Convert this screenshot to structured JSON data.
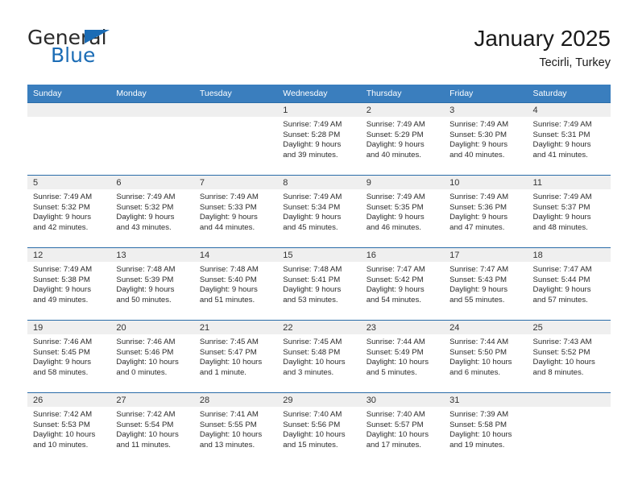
{
  "brand": {
    "name_top": "General",
    "name_bottom": "Blue",
    "triangle_icon": "triangle-icon",
    "accent_color": "#1b6cb5"
  },
  "header": {
    "title": "January 2025",
    "subtitle": "Tecirli, Turkey"
  },
  "theme": {
    "header_blue": "#3a7ebe",
    "row_divider_blue": "#2a6ca8",
    "daynum_band_gray": "#efefef"
  },
  "calendar": {
    "weekdays": [
      "Sunday",
      "Monday",
      "Tuesday",
      "Wednesday",
      "Thursday",
      "Friday",
      "Saturday"
    ],
    "weeks": [
      [
        {
          "day": "",
          "lines": []
        },
        {
          "day": "",
          "lines": []
        },
        {
          "day": "",
          "lines": []
        },
        {
          "day": "1",
          "lines": [
            "Sunrise: 7:49 AM",
            "Sunset: 5:28 PM",
            "Daylight: 9 hours",
            "and 39 minutes."
          ]
        },
        {
          "day": "2",
          "lines": [
            "Sunrise: 7:49 AM",
            "Sunset: 5:29 PM",
            "Daylight: 9 hours",
            "and 40 minutes."
          ]
        },
        {
          "day": "3",
          "lines": [
            "Sunrise: 7:49 AM",
            "Sunset: 5:30 PM",
            "Daylight: 9 hours",
            "and 40 minutes."
          ]
        },
        {
          "day": "4",
          "lines": [
            "Sunrise: 7:49 AM",
            "Sunset: 5:31 PM",
            "Daylight: 9 hours",
            "and 41 minutes."
          ]
        }
      ],
      [
        {
          "day": "5",
          "lines": [
            "Sunrise: 7:49 AM",
            "Sunset: 5:32 PM",
            "Daylight: 9 hours",
            "and 42 minutes."
          ]
        },
        {
          "day": "6",
          "lines": [
            "Sunrise: 7:49 AM",
            "Sunset: 5:32 PM",
            "Daylight: 9 hours",
            "and 43 minutes."
          ]
        },
        {
          "day": "7",
          "lines": [
            "Sunrise: 7:49 AM",
            "Sunset: 5:33 PM",
            "Daylight: 9 hours",
            "and 44 minutes."
          ]
        },
        {
          "day": "8",
          "lines": [
            "Sunrise: 7:49 AM",
            "Sunset: 5:34 PM",
            "Daylight: 9 hours",
            "and 45 minutes."
          ]
        },
        {
          "day": "9",
          "lines": [
            "Sunrise: 7:49 AM",
            "Sunset: 5:35 PM",
            "Daylight: 9 hours",
            "and 46 minutes."
          ]
        },
        {
          "day": "10",
          "lines": [
            "Sunrise: 7:49 AM",
            "Sunset: 5:36 PM",
            "Daylight: 9 hours",
            "and 47 minutes."
          ]
        },
        {
          "day": "11",
          "lines": [
            "Sunrise: 7:49 AM",
            "Sunset: 5:37 PM",
            "Daylight: 9 hours",
            "and 48 minutes."
          ]
        }
      ],
      [
        {
          "day": "12",
          "lines": [
            "Sunrise: 7:49 AM",
            "Sunset: 5:38 PM",
            "Daylight: 9 hours",
            "and 49 minutes."
          ]
        },
        {
          "day": "13",
          "lines": [
            "Sunrise: 7:48 AM",
            "Sunset: 5:39 PM",
            "Daylight: 9 hours",
            "and 50 minutes."
          ]
        },
        {
          "day": "14",
          "lines": [
            "Sunrise: 7:48 AM",
            "Sunset: 5:40 PM",
            "Daylight: 9 hours",
            "and 51 minutes."
          ]
        },
        {
          "day": "15",
          "lines": [
            "Sunrise: 7:48 AM",
            "Sunset: 5:41 PM",
            "Daylight: 9 hours",
            "and 53 minutes."
          ]
        },
        {
          "day": "16",
          "lines": [
            "Sunrise: 7:47 AM",
            "Sunset: 5:42 PM",
            "Daylight: 9 hours",
            "and 54 minutes."
          ]
        },
        {
          "day": "17",
          "lines": [
            "Sunrise: 7:47 AM",
            "Sunset: 5:43 PM",
            "Daylight: 9 hours",
            "and 55 minutes."
          ]
        },
        {
          "day": "18",
          "lines": [
            "Sunrise: 7:47 AM",
            "Sunset: 5:44 PM",
            "Daylight: 9 hours",
            "and 57 minutes."
          ]
        }
      ],
      [
        {
          "day": "19",
          "lines": [
            "Sunrise: 7:46 AM",
            "Sunset: 5:45 PM",
            "Daylight: 9 hours",
            "and 58 minutes."
          ]
        },
        {
          "day": "20",
          "lines": [
            "Sunrise: 7:46 AM",
            "Sunset: 5:46 PM",
            "Daylight: 10 hours",
            "and 0 minutes."
          ]
        },
        {
          "day": "21",
          "lines": [
            "Sunrise: 7:45 AM",
            "Sunset: 5:47 PM",
            "Daylight: 10 hours",
            "and 1 minute."
          ]
        },
        {
          "day": "22",
          "lines": [
            "Sunrise: 7:45 AM",
            "Sunset: 5:48 PM",
            "Daylight: 10 hours",
            "and 3 minutes."
          ]
        },
        {
          "day": "23",
          "lines": [
            "Sunrise: 7:44 AM",
            "Sunset: 5:49 PM",
            "Daylight: 10 hours",
            "and 5 minutes."
          ]
        },
        {
          "day": "24",
          "lines": [
            "Sunrise: 7:44 AM",
            "Sunset: 5:50 PM",
            "Daylight: 10 hours",
            "and 6 minutes."
          ]
        },
        {
          "day": "25",
          "lines": [
            "Sunrise: 7:43 AM",
            "Sunset: 5:52 PM",
            "Daylight: 10 hours",
            "and 8 minutes."
          ]
        }
      ],
      [
        {
          "day": "26",
          "lines": [
            "Sunrise: 7:42 AM",
            "Sunset: 5:53 PM",
            "Daylight: 10 hours",
            "and 10 minutes."
          ]
        },
        {
          "day": "27",
          "lines": [
            "Sunrise: 7:42 AM",
            "Sunset: 5:54 PM",
            "Daylight: 10 hours",
            "and 11 minutes."
          ]
        },
        {
          "day": "28",
          "lines": [
            "Sunrise: 7:41 AM",
            "Sunset: 5:55 PM",
            "Daylight: 10 hours",
            "and 13 minutes."
          ]
        },
        {
          "day": "29",
          "lines": [
            "Sunrise: 7:40 AM",
            "Sunset: 5:56 PM",
            "Daylight: 10 hours",
            "and 15 minutes."
          ]
        },
        {
          "day": "30",
          "lines": [
            "Sunrise: 7:40 AM",
            "Sunset: 5:57 PM",
            "Daylight: 10 hours",
            "and 17 minutes."
          ]
        },
        {
          "day": "31",
          "lines": [
            "Sunrise: 7:39 AM",
            "Sunset: 5:58 PM",
            "Daylight: 10 hours",
            "and 19 minutes."
          ]
        },
        {
          "day": "",
          "lines": []
        }
      ]
    ]
  }
}
